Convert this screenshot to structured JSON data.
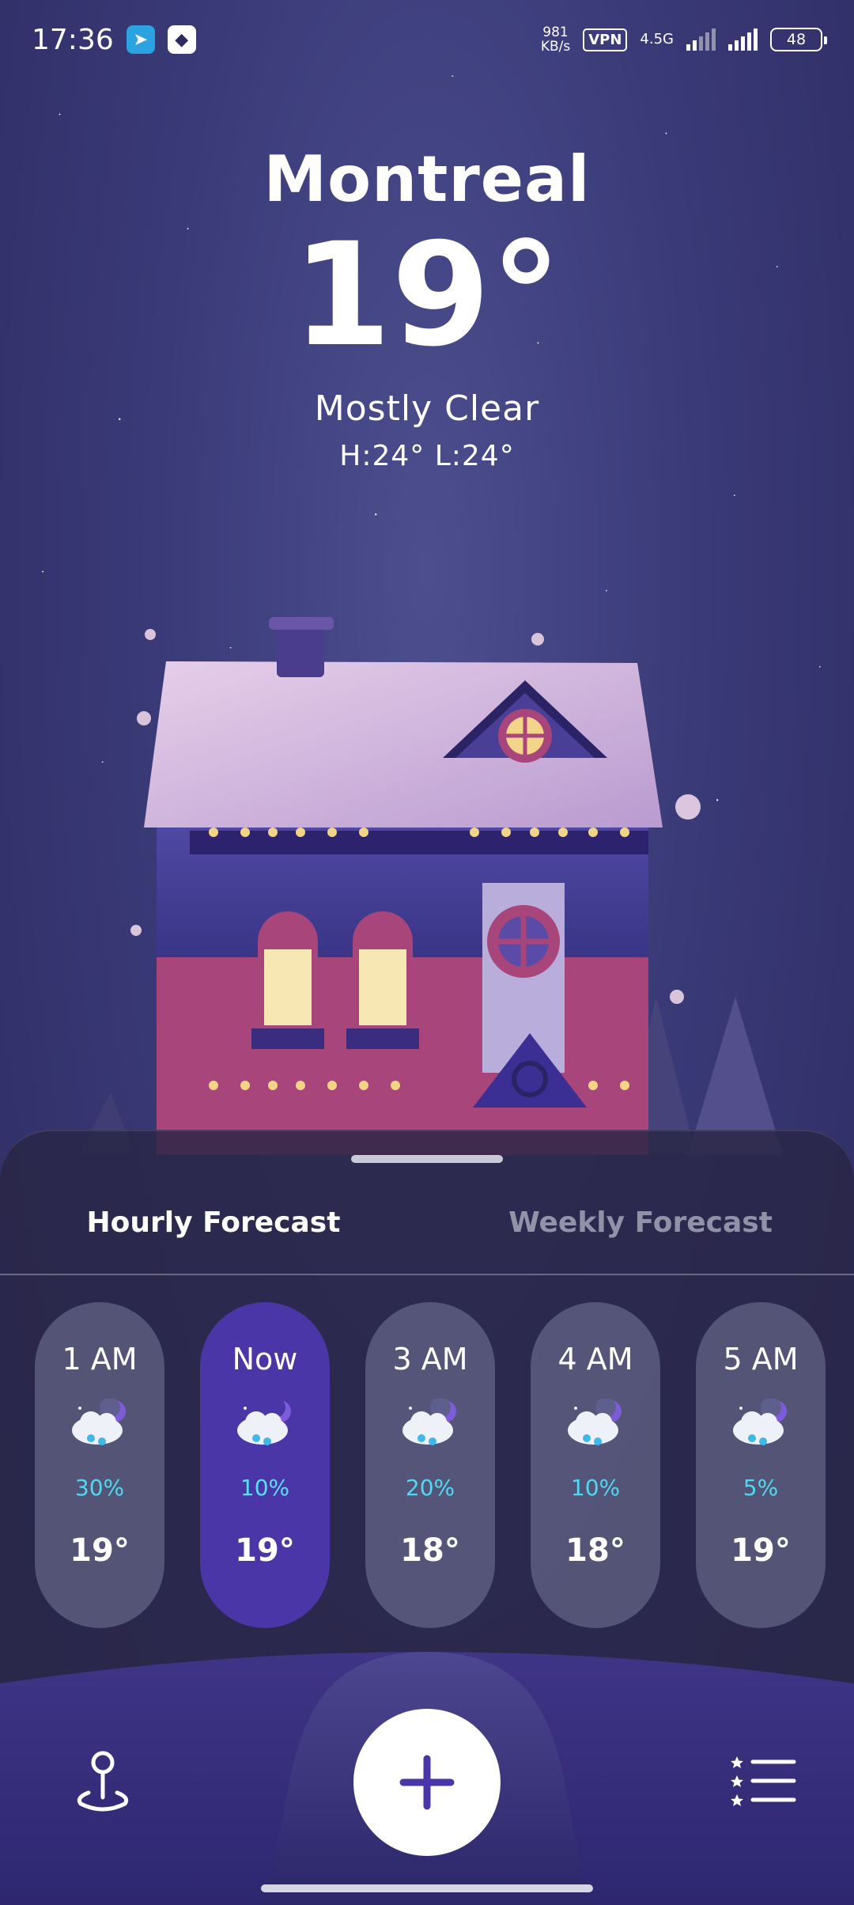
{
  "status_bar": {
    "time": "17:36",
    "speed_value": "981",
    "speed_unit": "KB/s",
    "vpn": "VPN",
    "network": "4.5G",
    "battery": "48"
  },
  "weather": {
    "city": "Montreal",
    "temperature": "19°",
    "condition": "Mostly Clear",
    "hi_lo": "H:24°  L:24°"
  },
  "tabs": {
    "hourly": "Hourly Forecast",
    "weekly": "Weekly Forecast"
  },
  "hourly": [
    {
      "time": "1 AM",
      "precip": "30%",
      "temp": "19°",
      "icon": "night-snow-cloud-icon"
    },
    {
      "time": "Now",
      "precip": "10%",
      "temp": "19°",
      "icon": "night-snow-cloud-icon"
    },
    {
      "time": "3 AM",
      "precip": "20%",
      "temp": "18°",
      "icon": "night-snow-cloud-icon"
    },
    {
      "time": "4 AM",
      "precip": "10%",
      "temp": "18°",
      "icon": "night-snow-cloud-icon"
    },
    {
      "time": "5 AM",
      "precip": "5%",
      "temp": "19°",
      "icon": "night-snow-cloud-icon"
    }
  ],
  "nav": {
    "left_icon": "location-pin-icon",
    "center_icon": "plus-icon",
    "right_icon": "starred-list-icon"
  },
  "colors": {
    "background": "#3a3a78",
    "sheet": "#28264a",
    "accent": "#4a36a6",
    "precip": "#4fd9f3"
  }
}
